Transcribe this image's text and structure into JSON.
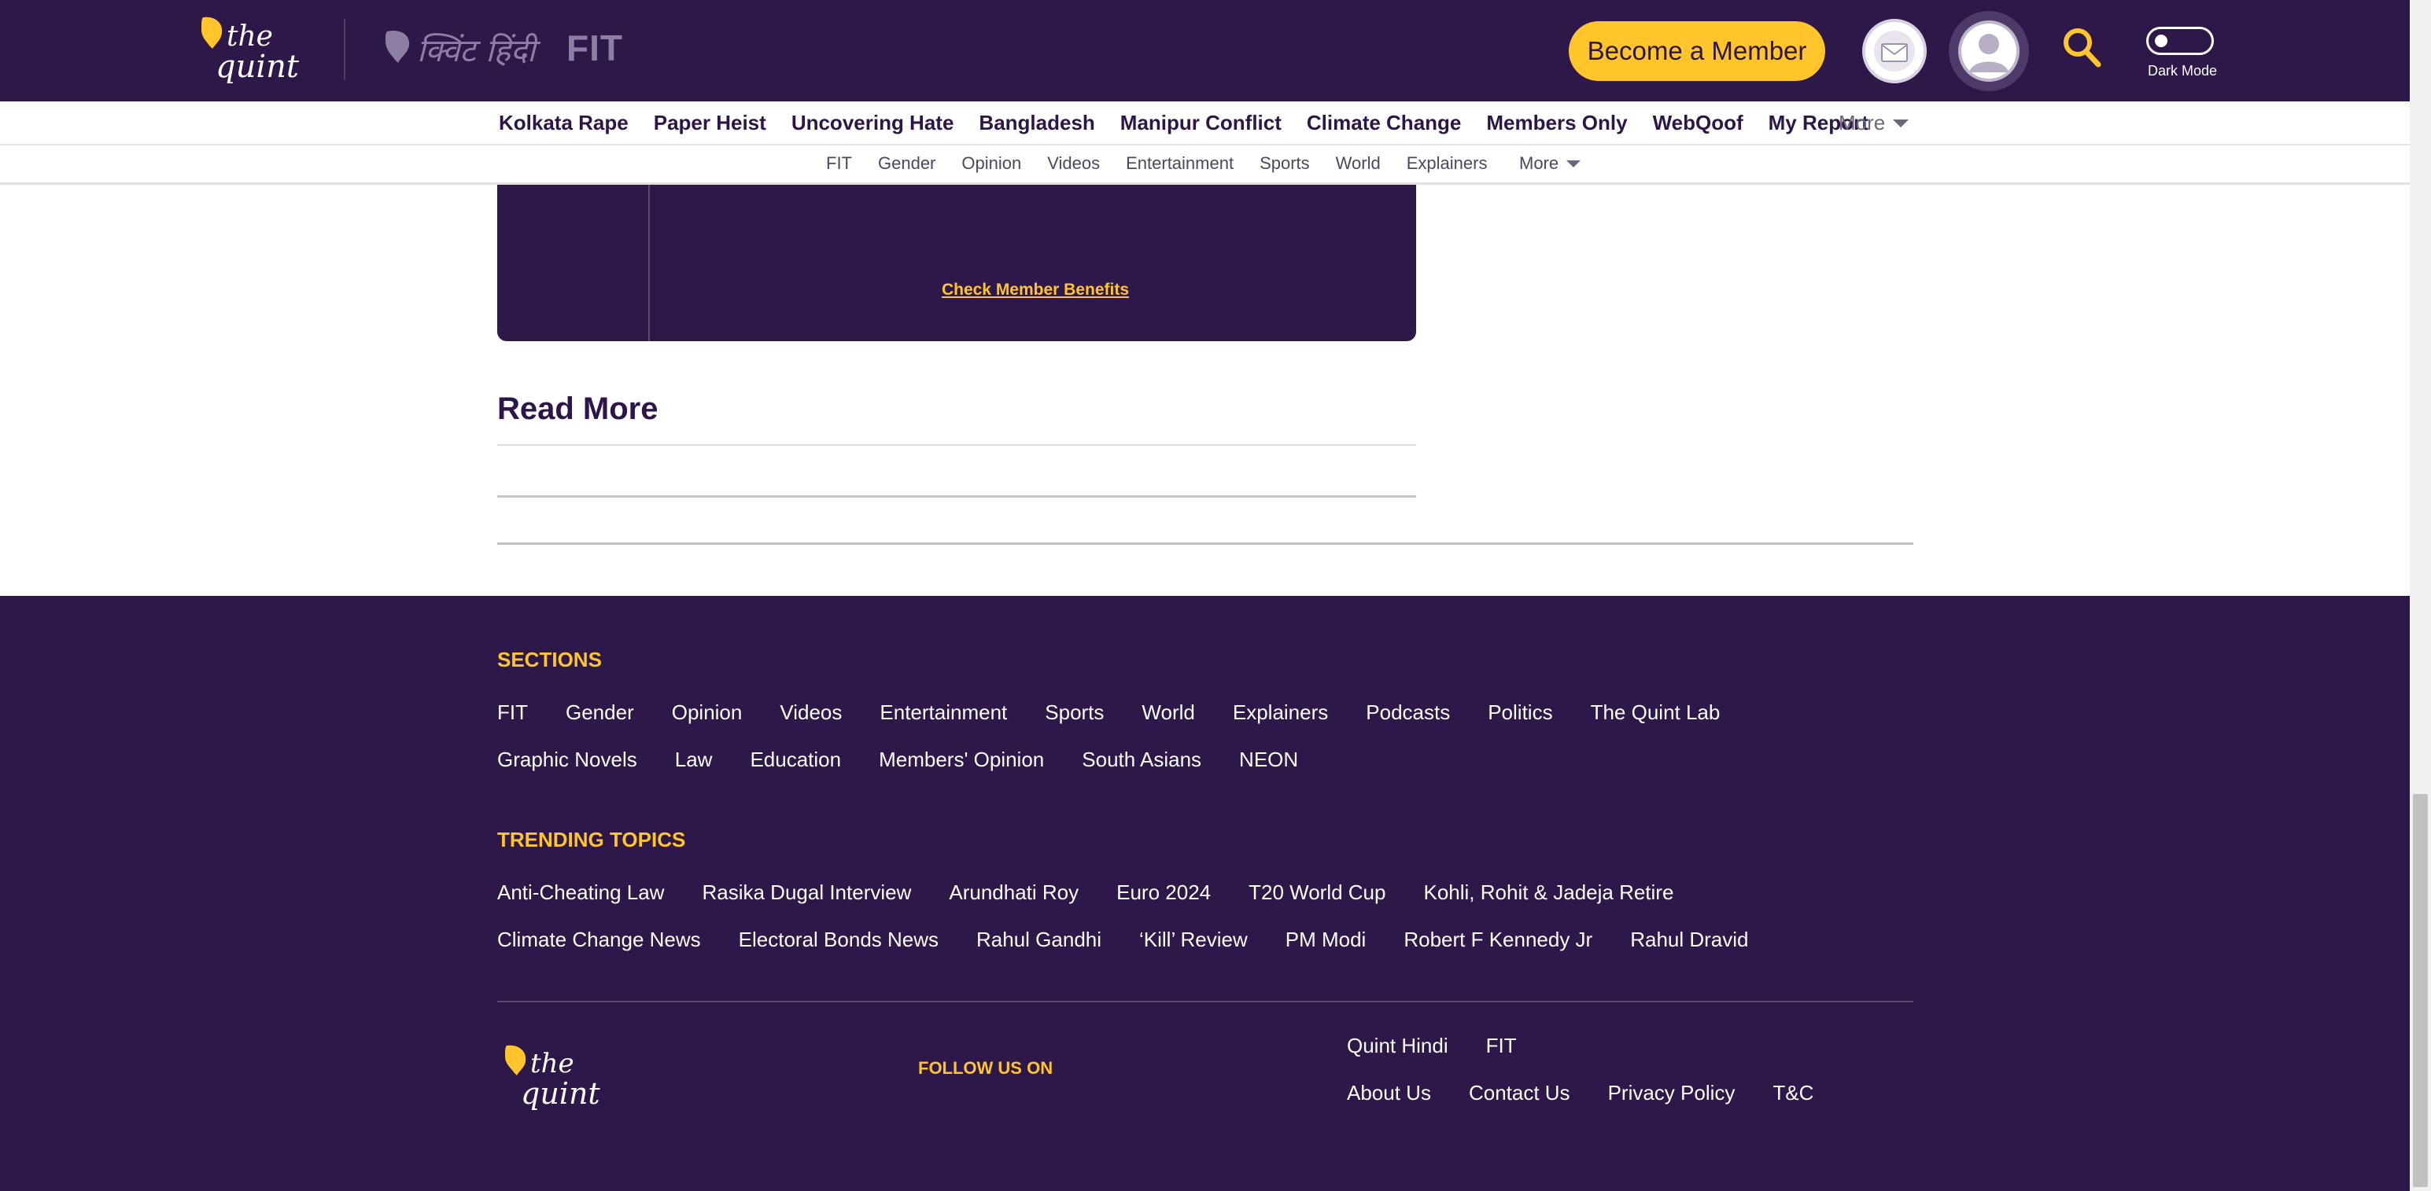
{
  "header": {
    "logo_text_line1": "the",
    "logo_text_line2": "quint",
    "hindi_logo_text": "क्विंट हिंदी",
    "fit_logo_text": "FIT",
    "member_button": "Become a Member",
    "dark_mode_label": "Dark Mode",
    "icons": [
      "mail-icon",
      "avatar-icon",
      "search-icon",
      "toggle-icon"
    ]
  },
  "primary_nav": {
    "items": [
      "Kolkata Rape",
      "Paper Heist",
      "Uncovering Hate",
      "Bangladesh",
      "Manipur Conflict",
      "Climate Change",
      "Members Only",
      "WebQoof",
      "My Report"
    ],
    "more": "More"
  },
  "secondary_nav": {
    "items": [
      "FIT",
      "Gender",
      "Opinion",
      "Videos",
      "Entertainment",
      "Sports",
      "World",
      "Explainers"
    ],
    "more": "More"
  },
  "member_box": {
    "benefits_link": "Check Member Benefits"
  },
  "read_more": {
    "heading": "Read More"
  },
  "footer": {
    "sections_heading": "SECTIONS",
    "sections_row1": [
      "FIT",
      "Gender",
      "Opinion",
      "Videos",
      "Entertainment",
      "Sports",
      "World",
      "Explainers",
      "Podcasts",
      "Politics",
      "The Quint Lab"
    ],
    "sections_row2": [
      "Graphic Novels",
      "Law",
      "Education",
      "Members' Opinion",
      "South Asians",
      "NEON"
    ],
    "trending_heading": "TRENDING TOPICS",
    "trending_row1": [
      "Anti-Cheating Law",
      "Rasika Dugal Interview",
      "Arundhati Roy",
      "Euro 2024",
      "T20 World Cup",
      "Kohli, Rohit & Jadeja Retire"
    ],
    "trending_row2": [
      "Climate Change News",
      "Electoral Bonds News",
      "Rahul Gandhi",
      "‘Kill’ Review",
      "PM Modi",
      "Robert F Kennedy Jr",
      "Rahul Dravid"
    ],
    "follow_us": "FOLLOW US ON",
    "links_row1": [
      "Quint Hindi",
      "FIT"
    ],
    "links_row2": [
      "About Us",
      "Contact Us",
      "Privacy Policy",
      "T&C"
    ]
  },
  "colors": {
    "brand_purple": "#2e1749",
    "accent_yellow": "#ffc52b",
    "white": "#ffffff"
  }
}
